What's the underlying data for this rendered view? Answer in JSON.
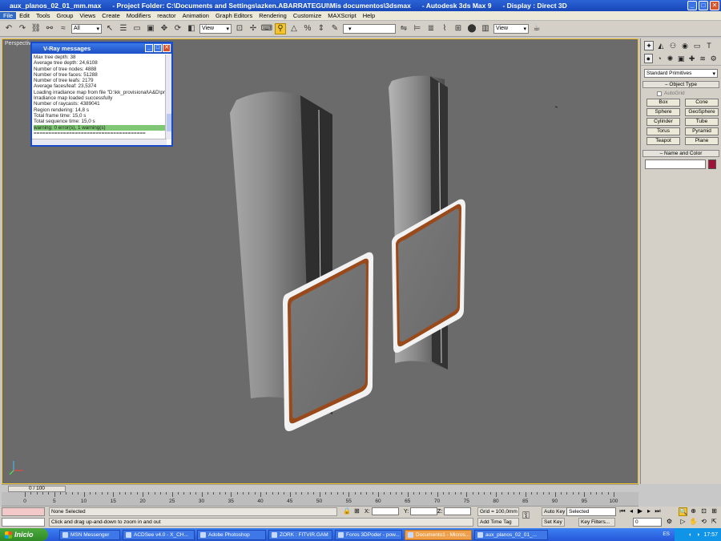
{
  "window": {
    "file": "aux_planos_02_01_mm.max",
    "project_folder": "- Project Folder: C:\\Documents and Settings\\azken.ABARRATEGUI\\Mis documentos\\3dsmax",
    "app": "- Autodesk 3ds Max 9",
    "display": "- Display : Direct 3D"
  },
  "menu": [
    "File",
    "Edit",
    "Tools",
    "Group",
    "Views",
    "Create",
    "Modifiers",
    "reactor",
    "Animation",
    "Graph Editors",
    "Rendering",
    "Customize",
    "MAXScript",
    "Help"
  ],
  "toolbar": {
    "selection_filter": "All",
    "ref_coord": "View",
    "named_sel": "",
    "ref_coord2": "View"
  },
  "viewport": {
    "label": "Perspective"
  },
  "vray": {
    "title": "V-Ray messages",
    "lines": [
      "Max tree depth: 38",
      "Average tree depth: 24,6108",
      "Number of tree nodes: 4888",
      "Number of tree faces: 51288",
      "Number of tree leafs: 2179",
      "Average faces/leaf: 23,5374",
      "Loading irradiance map from file \"D:\\kk_provisional\\A&D\\pr_k",
      "Irradiance map loaded successfully",
      "Number of raycasts: 4389041",
      "Region rendering: 14,8 s",
      "Total frame time: 15,0 s",
      "Total sequence time: 15,0 s"
    ],
    "warning": "warning: 0 error(s), 1 warning(s)",
    "last": "======================================"
  },
  "command_panel": {
    "category": "Standard Primitives",
    "object_type": "Object Type",
    "autogrid": "AutoGrid",
    "buttons": [
      "Box",
      "Cone",
      "Sphere",
      "GeoSphere",
      "Cylinder",
      "Tube",
      "Torus",
      "Pyramid",
      "Teapot",
      "Plane"
    ],
    "name_and_color": "Name and Color",
    "object_color": "#a0123a"
  },
  "timeline": {
    "slider": "0 / 100",
    "ticks": [
      "0",
      "5",
      "10",
      "15",
      "20",
      "25",
      "30",
      "35",
      "40",
      "45",
      "50",
      "55",
      "60",
      "65",
      "70",
      "75",
      "80",
      "85",
      "90",
      "95",
      "100"
    ]
  },
  "status": {
    "selection": "None Selected",
    "prompt": "Click and drag up-and-down to zoom in and out",
    "x_label": "X:",
    "y_label": "Y:",
    "z_label": "Z:",
    "grid": "Grid = 100,0mm",
    "add_time_tag": "Add Time Tag",
    "auto_key": "Auto Key",
    "auto_key_mode": "Selected",
    "set_key": "Set Key",
    "key_filters": "Key Filters...",
    "frame": "0"
  },
  "taskbar": {
    "start": "Inicio",
    "tasks": [
      "MSN Messenger",
      "ACDSee v4.0 - X_CH...",
      "Adobe Photoshop",
      "ZORK : FITVIR.GAM",
      "Foros 3DPoder - pow...",
      "Documento1 - Micros...",
      "aux_planos_02_01_..."
    ],
    "active_task": 5,
    "lang": "ES",
    "clock": "17:57"
  }
}
